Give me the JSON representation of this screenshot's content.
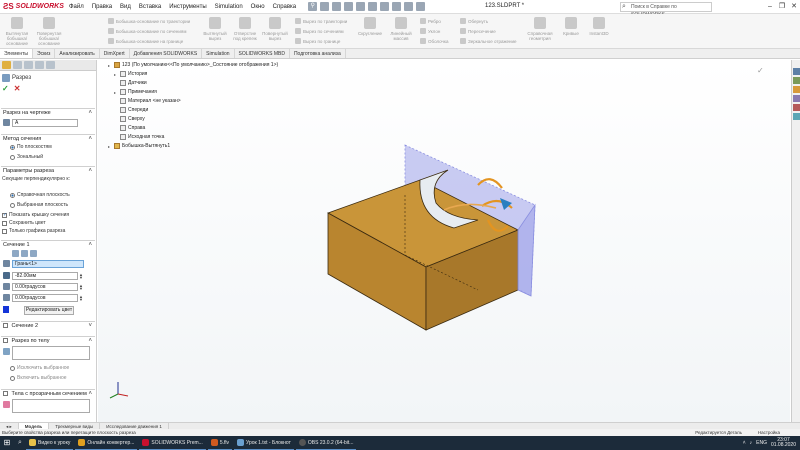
{
  "app": {
    "brand": "SOLIDWORKS",
    "document_title": "123.SLDPRT *",
    "search_placeholder": "Поиск в Справке по SOLIDWORKS",
    "menu": [
      "Файл",
      "Правка",
      "Вид",
      "Вставка",
      "Инструменты",
      "Simulation",
      "Окно",
      "Справка"
    ]
  },
  "ribbon": {
    "big_buttons": [
      "Вытянутая бобышка/основание",
      "Повернутая бобышка/основание",
      "Вытянутый вырез",
      "Отверстие под крепеж",
      "Повернутый вырез",
      "Скругление",
      "Линейный массив",
      "Справочная геометрия",
      "Кривые",
      "Instant3D"
    ],
    "small_buttons": [
      "Бобышка-основание по траектории",
      "Бобышка-основание по сечениям",
      "Бобышка-основание на границе",
      "Вырез по траектории",
      "Вырез по сечениям",
      "Вырез по границе",
      "Ребро",
      "Уклон",
      "Оболочка",
      "Обернуть",
      "Пересечение",
      "Зеркальное отражение"
    ]
  },
  "command_tabs": [
    "Элементы",
    "Эскиз",
    "Анализировать",
    "DimXpert",
    "Добавления SOLIDWORKS",
    "Simulation",
    "SOLIDWORKS MBD",
    "Подготовка анализа"
  ],
  "property_manager": {
    "title": "Разрез",
    "ok": "✓",
    "cancel": "✕",
    "sec_drawing": "Разрез на чертеже",
    "drawing_value": "А",
    "sec_method": "Метод сечения",
    "method_plane": "По плоскостям",
    "method_zonal": "Зональный",
    "sec_params": "Параметры разреза",
    "perp_label": "Секущие перпендикулярно к:",
    "param_ref": "Справочная плоскость",
    "param_sel": "Выбранная плоскость",
    "show_cap": "Показать крышку сечения",
    "keep_color": "Сохранить цвет",
    "only_graphics": "Только графика разреза",
    "sec1": "Сечение 1",
    "face_value": "Грань<1>",
    "offset_value": "-82.00мм",
    "angle1_value": "0.00градусов",
    "angle2_value": "0.00градусов",
    "edit_color": "Редактировать цвет",
    "sec2": "Сечение 2",
    "sec_body": "Разрез по телу",
    "exclude_sel": "Исключить выбранное",
    "include_sel": "Включить выбранное",
    "sec_transp": "Тела с прозрачным сечением",
    "cap_color": "#1535d8"
  },
  "feature_tree": {
    "root": "123  (По умолчанию<<По умолчанию>_Состояние отображения 1>)",
    "items": [
      "История",
      "Датчики",
      "Примечания",
      "Материал <не указан>",
      "Спереди",
      "Сверху",
      "Справа",
      "Исходная точка",
      "Бобышка-Вытянуть1"
    ]
  },
  "bottom_tabs": [
    "Модель",
    "Трехмерные виды",
    "Исследование движения 1"
  ],
  "status": {
    "left": "Выберите свойства разреза или перетащите плоскость разреза",
    "right": "Редактируется Деталь",
    "units": "Настройка"
  },
  "taskbar": {
    "items": [
      "Видео к уроку",
      "Онлайн конвертер...",
      "SOLIDWORKS Prem...",
      "5.flv",
      "Урок 1.txt - Блокнот",
      "OBS 23.0.2 (64-bit..."
    ],
    "lang": "ENG",
    "time": "23:07",
    "date": "01.08.2020"
  },
  "colors": {
    "part": "#c9933a",
    "plane": "#8a8fe0",
    "accent": "#e08a1e"
  }
}
